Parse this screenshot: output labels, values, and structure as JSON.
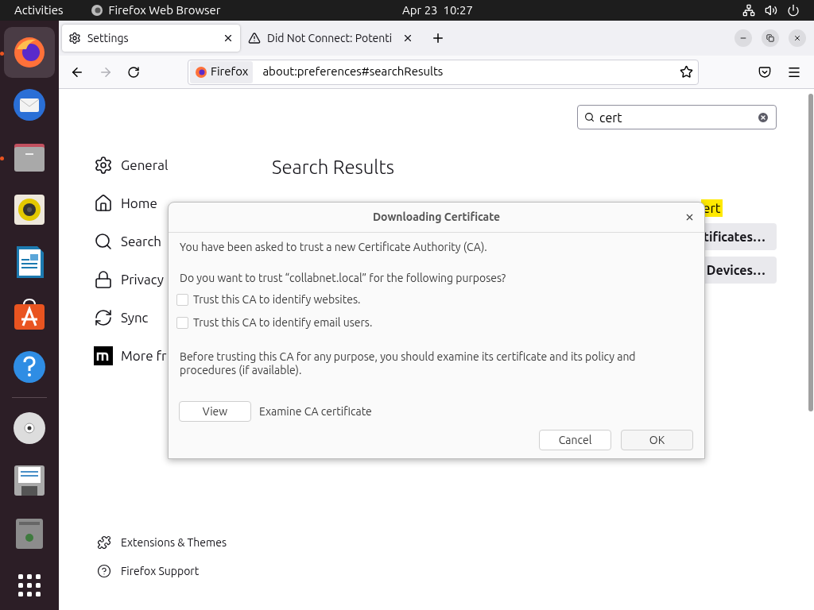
{
  "top_bar": {
    "activities": "Activities",
    "app": "Firefox Web Browser",
    "clock": "Apr 23  10:27"
  },
  "dock": [
    {
      "kind": "firefox",
      "running": true,
      "selected": true
    },
    {
      "kind": "mail",
      "running": false,
      "selected": false
    },
    {
      "kind": "files",
      "running": true,
      "selected": false
    },
    {
      "kind": "speaker",
      "running": false,
      "selected": false
    },
    {
      "kind": "writer",
      "running": false,
      "selected": false
    },
    {
      "kind": "store",
      "running": false,
      "selected": false
    },
    {
      "kind": "help",
      "running": false,
      "selected": false
    },
    {
      "kind": "disc",
      "running": false,
      "selected": false
    },
    {
      "kind": "save",
      "running": false,
      "selected": false
    },
    {
      "kind": "trash",
      "running": false,
      "selected": false
    },
    {
      "kind": "apps",
      "running": false,
      "selected": false
    }
  ],
  "tabs": [
    {
      "label": "Settings",
      "kind": "gear",
      "selected": true
    },
    {
      "label": "Did Not Connect: Potenti",
      "kind": "warning",
      "selected": false
    }
  ],
  "address_bar": {
    "identity": "Firefox",
    "url": "about:preferences#searchResults"
  },
  "search": {
    "value": "cert"
  },
  "nav": [
    {
      "label": "General",
      "kind": "gear"
    },
    {
      "label": "Home",
      "kind": "home"
    },
    {
      "label": "Search",
      "kind": "search"
    },
    {
      "label": "Privacy",
      "kind": "lock"
    },
    {
      "label": "Sync",
      "kind": "sync"
    },
    {
      "label": "More fr",
      "kind": "m"
    }
  ],
  "heading": "Search Results",
  "results": {
    "highlight": "ert",
    "buttons": [
      "tificates…",
      "Devices…"
    ]
  },
  "footer_links": [
    {
      "label": "Extensions & Themes",
      "kind": "puzzle"
    },
    {
      "label": "Firefox Support",
      "kind": "help"
    }
  ],
  "dialog": {
    "title": "Downloading Certificate",
    "intro": "You have been asked to trust a new Certificate Authority (CA).",
    "question": "Do you want to trust “collabnet.local” for the following purposes?",
    "options": [
      {
        "label": "Trust this CA to identify websites.",
        "checked": false
      },
      {
        "label": "Trust this CA to identify email users.",
        "checked": false
      }
    ],
    "note": "Before trusting this CA for any purpose, you should examine its certificate and its policy and procedures (if available).",
    "view_button": "View",
    "view_label": "Examine CA certificate",
    "buttons": [
      "Cancel",
      "OK"
    ]
  }
}
